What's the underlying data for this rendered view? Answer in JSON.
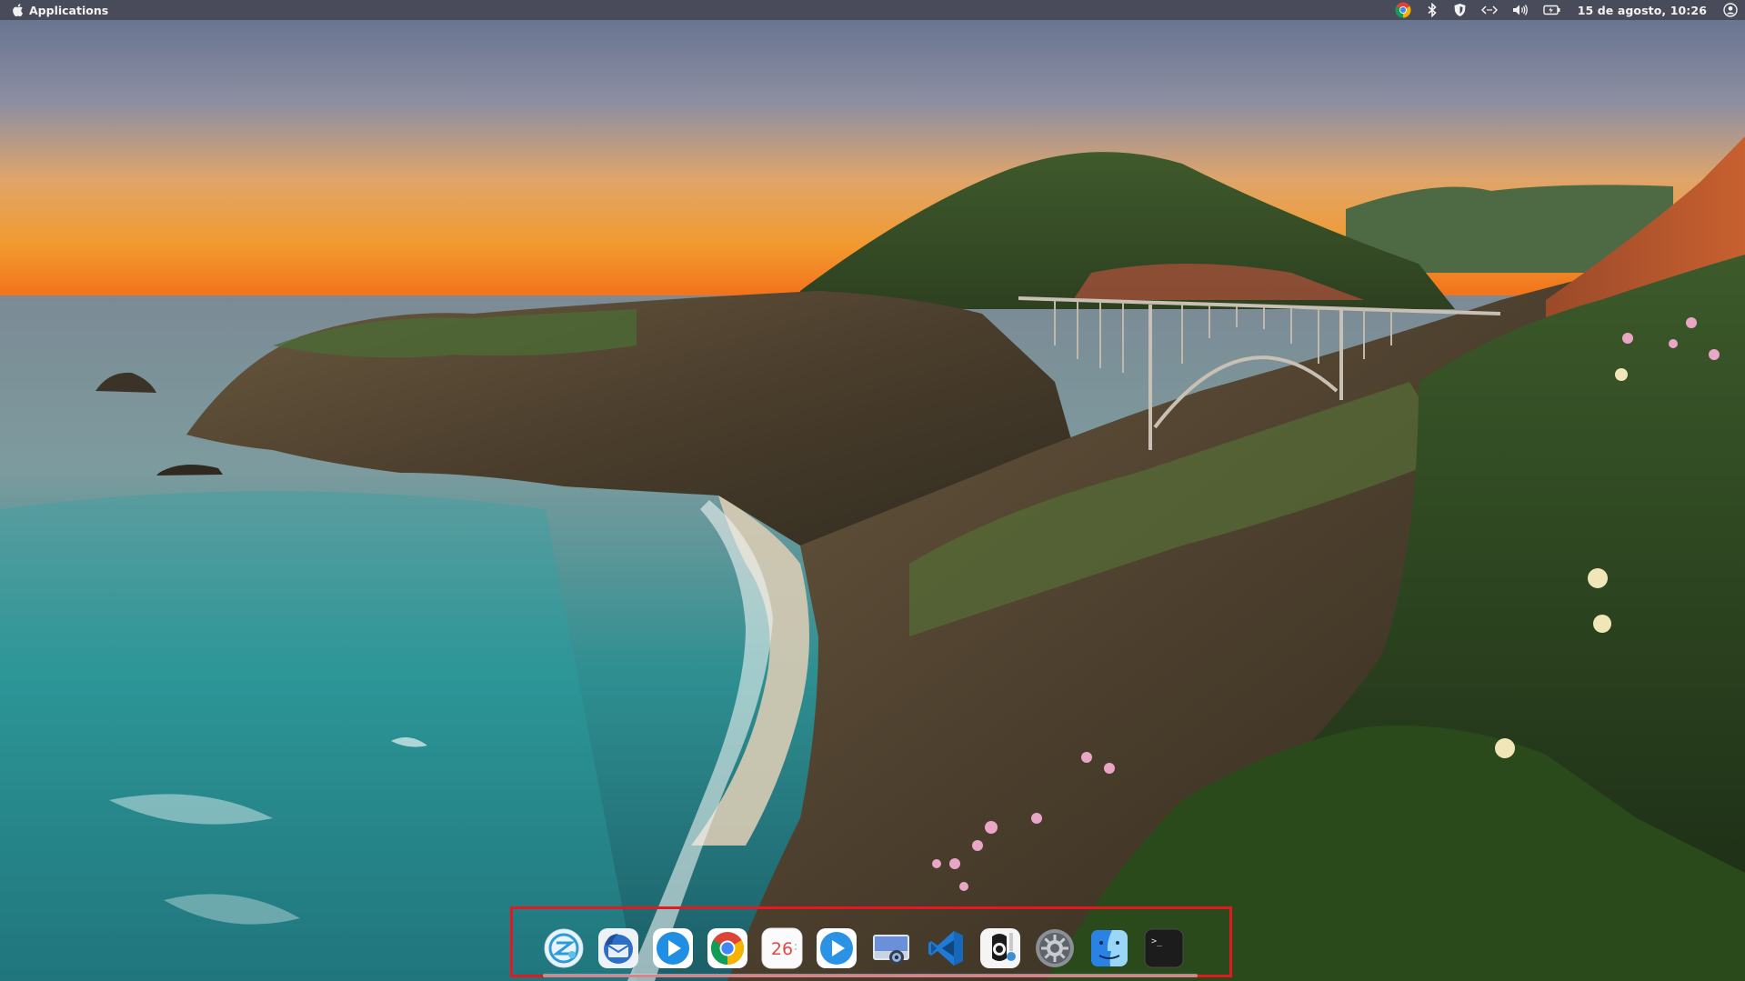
{
  "panel": {
    "apps_label": "Applications",
    "clock": "15 de agosto, 10:26",
    "tray_icons": [
      "chrome-icon",
      "bluetooth-icon",
      "vpn-shield-icon",
      "network-icon",
      "volume-icon",
      "battery-icon",
      "user-account-icon"
    ]
  },
  "dock": {
    "highlight_color": "#e4191f",
    "items": [
      {
        "name": "remote-desktop-app",
        "icon": "remote-desktop-icon"
      },
      {
        "name": "thunderbird-app",
        "icon": "thunderbird-icon"
      },
      {
        "name": "media-player-app",
        "icon": "play-icon"
      },
      {
        "name": "chrome-app",
        "icon": "chrome-icon"
      },
      {
        "name": "calendar-app",
        "icon": "calendar-icon",
        "label": "26"
      },
      {
        "name": "video-player-app",
        "icon": "play-icon"
      },
      {
        "name": "screenshot-app",
        "icon": "screenshot-icon"
      },
      {
        "name": "vscode-app",
        "icon": "vscode-icon"
      },
      {
        "name": "guitar-app",
        "icon": "guitar-icon"
      },
      {
        "name": "system-settings-app",
        "icon": "gear-icon"
      },
      {
        "name": "finder-app",
        "icon": "finder-icon"
      },
      {
        "name": "terminal-app",
        "icon": "terminal-icon",
        "label": ">_"
      }
    ]
  },
  "colors": {
    "panel_bg": "#464856",
    "panel_text": "#f2f2f2"
  }
}
